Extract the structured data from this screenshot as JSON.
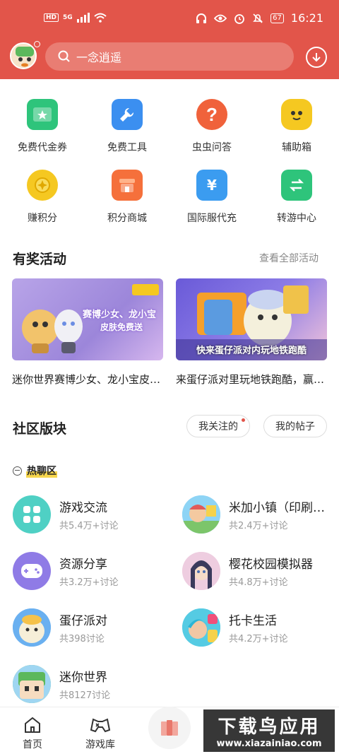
{
  "status_bar": {
    "hd": "HD",
    "network": "5G",
    "battery": "67",
    "time": "16:21"
  },
  "search": {
    "placeholder": "一念逍遥"
  },
  "shortcuts": [
    {
      "label": "免费代金券",
      "icon": "coupon-icon",
      "color": "#2ec47b"
    },
    {
      "label": "免费工具",
      "icon": "toolbox-icon",
      "color": "#3b8ff0"
    },
    {
      "label": "虫虫问答",
      "icon": "question-icon",
      "color": "#f0623b"
    },
    {
      "label": "辅助箱",
      "icon": "robot-icon",
      "color": "#f5c821"
    },
    {
      "label": "赚积分",
      "icon": "coin-icon",
      "color": "#f5c821"
    },
    {
      "label": "积分商城",
      "icon": "shop-icon",
      "color": "#f5703b"
    },
    {
      "label": "国际服代充",
      "icon": "wallet-icon",
      "color": "#3b9cf0"
    },
    {
      "label": "转游中心",
      "icon": "swap-icon",
      "color": "#2ec47b"
    }
  ],
  "activities": {
    "title": "有奖活动",
    "more": "查看全部活动",
    "items": [
      {
        "caption": "迷你世界赛博少女、龙小宝皮肤免费送",
        "banner_text_1": "赛博少女、龙小宝",
        "banner_text_2": "皮肤免费送"
      },
      {
        "caption": "来蛋仔派对里玩地铁跑酷，赢好礼",
        "banner_text_1": "快来蛋仔派对内玩地铁跑酷"
      }
    ]
  },
  "community": {
    "title": "社区版块",
    "following": "我关注的",
    "my_posts": "我的帖子",
    "hot_label": "热聊区",
    "forums": [
      {
        "name": "游戏交流",
        "count": "共5.4万+讨论"
      },
      {
        "name": "米加小镇（印刷版）",
        "count": "共2.4万+讨论"
      },
      {
        "name": "资源分享",
        "count": "共3.2万+讨论"
      },
      {
        "name": "樱花校园模拟器",
        "count": "共4.8万+讨论"
      },
      {
        "name": "蛋仔派对",
        "count": "共398讨论"
      },
      {
        "name": "托卡生活",
        "count": "共4.2万+讨论"
      },
      {
        "name": "迷你世界",
        "count": "共8127讨论"
      }
    ]
  },
  "nav": {
    "home": "首页",
    "library": "游戏库"
  },
  "watermark": {
    "title": "下载鸟应用",
    "url": "www.xiazainiao.com"
  }
}
